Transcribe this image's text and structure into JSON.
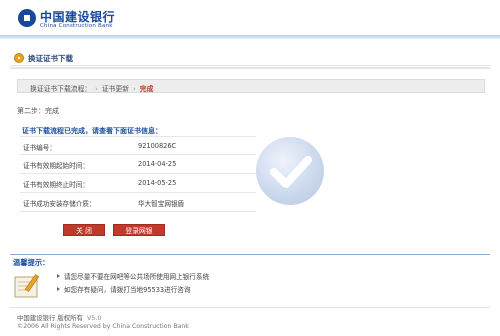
{
  "header": {
    "bank_name_cn": "中国建设银行",
    "bank_name_en": "China Construction Bank"
  },
  "page": {
    "title": "换证证书下载"
  },
  "steps": {
    "items": [
      "换证证书下载流程：",
      "证书更新",
      "完成"
    ],
    "separator": "›",
    "current_index": 2,
    "current_color": "#c0392b"
  },
  "step_label": "第二步：完成",
  "success_message": "证书下载流程已完成，请查看下面证书信息：",
  "cert_info": [
    {
      "label": "证书编号：",
      "value": "92100826C"
    },
    {
      "label": "证书有效期起始时间：",
      "value": "2014-04-25"
    },
    {
      "label": "证书有效期终止时间：",
      "value": "2014-05-25"
    },
    {
      "label": "证书成功安装存储介质：",
      "value": "华大智宝网银盾"
    }
  ],
  "buttons": {
    "close_label": "关 闭",
    "login_label": "登录网银",
    "color": "#c0392b"
  },
  "tips": {
    "title": "温馨提示：",
    "items": [
      "请您尽量不要在网吧等公共场所使用网上银行系统",
      "如您存有疑问，请拨打当地95533进行咨询"
    ]
  },
  "footer": {
    "line1": "中国建设银行 版权所有",
    "version": "V5.0",
    "line2": "©2006 All Rights Reserved by China Construction Bank"
  },
  "colors": {
    "brand_blue": "#17489b",
    "link_blue": "#1f4fa0"
  }
}
